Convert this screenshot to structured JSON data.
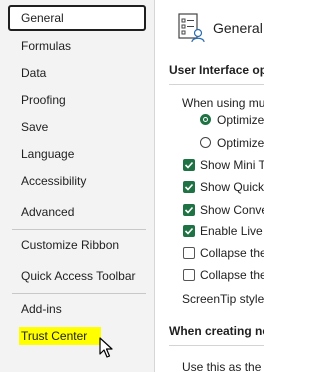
{
  "nav": {
    "items": [
      {
        "label": "General",
        "selected": true
      },
      {
        "label": "Formulas"
      },
      {
        "label": "Data"
      },
      {
        "label": "Proofing"
      },
      {
        "label": "Save"
      },
      {
        "label": "Language"
      },
      {
        "label": "Accessibility"
      },
      {
        "label": "Advanced"
      },
      {
        "label": "Customize Ribbon"
      },
      {
        "label": "Quick Access Toolbar"
      },
      {
        "label": "Add-ins"
      },
      {
        "label": "Trust Center",
        "highlight_color": "#ffff00"
      }
    ]
  },
  "content": {
    "title": "General",
    "title_icon": "general-settings-icon",
    "section_ui": "User Interface op",
    "when_using": "When using mu",
    "radios": [
      {
        "label": "Optimize",
        "checked": true
      },
      {
        "label": "Optimize",
        "checked": false
      }
    ],
    "checkboxes": [
      {
        "label": "Show Mini T",
        "checked": true
      },
      {
        "label": "Show Quick",
        "checked": true
      },
      {
        "label": "Show Conve",
        "checked": true
      },
      {
        "label": "Enable Live",
        "checked": true
      },
      {
        "label": "Collapse the",
        "checked": false
      },
      {
        "label": "Collapse the",
        "checked": false
      }
    ],
    "screentip_label": "ScreenTip style:",
    "section_new": "When creating ne",
    "use_this": "Use this as the d"
  },
  "colors": {
    "accent": "#1f7244",
    "highlight": "#ffff00",
    "nav_background": "#f3f3f3"
  }
}
